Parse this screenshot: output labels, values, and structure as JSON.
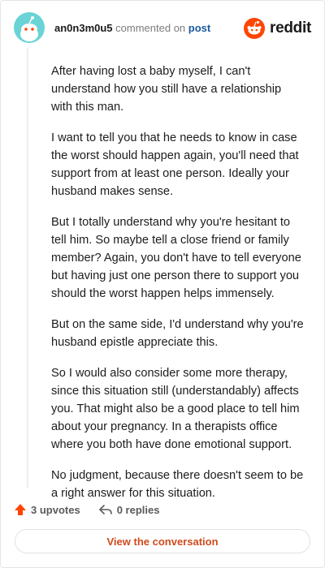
{
  "header": {
    "username": "an0n3m0u5",
    "action_text": "commented on",
    "post_link": "post",
    "brand": "reddit",
    "avatar_icon": "snoo-avatar-icon",
    "brand_icon": "reddit-logo-icon"
  },
  "comment": {
    "paragraphs": [
      "After having lost a baby myself, I can't understand how you still have a relationship with this man.",
      "I want to tell you that he needs to know in case the worst should happen again, you'll need that support from at least one person. Ideally your husband makes sense.",
      "But I totally understand why you're hesitant to tell him. So maybe tell a close friend or family member? Again, you don't have to tell everyone but having just one person there to support you should the worst happen helps immensely.",
      "But on the same side, I'd understand why you're husband epistle appreciate this.",
      "So I would also consider some more therapy, since this situation still (understandably) affects you. That might also be a good place to tell him about your pregnancy. In a therapists office where you both have done emotional support.",
      "No judgment, because there doesn't seem to be a right answer for this situation."
    ]
  },
  "footer": {
    "upvotes": "3 upvotes",
    "replies": "0 replies",
    "upvote_icon": "upvote-arrow-icon",
    "reply_icon": "reply-arrow-icon"
  },
  "cta": {
    "label": "View the conversation"
  },
  "colors": {
    "accent": "#ff4500",
    "link": "#1a5a9e",
    "avatar_bg": "#6ad3d6",
    "cta_text": "#cf4a1c"
  }
}
